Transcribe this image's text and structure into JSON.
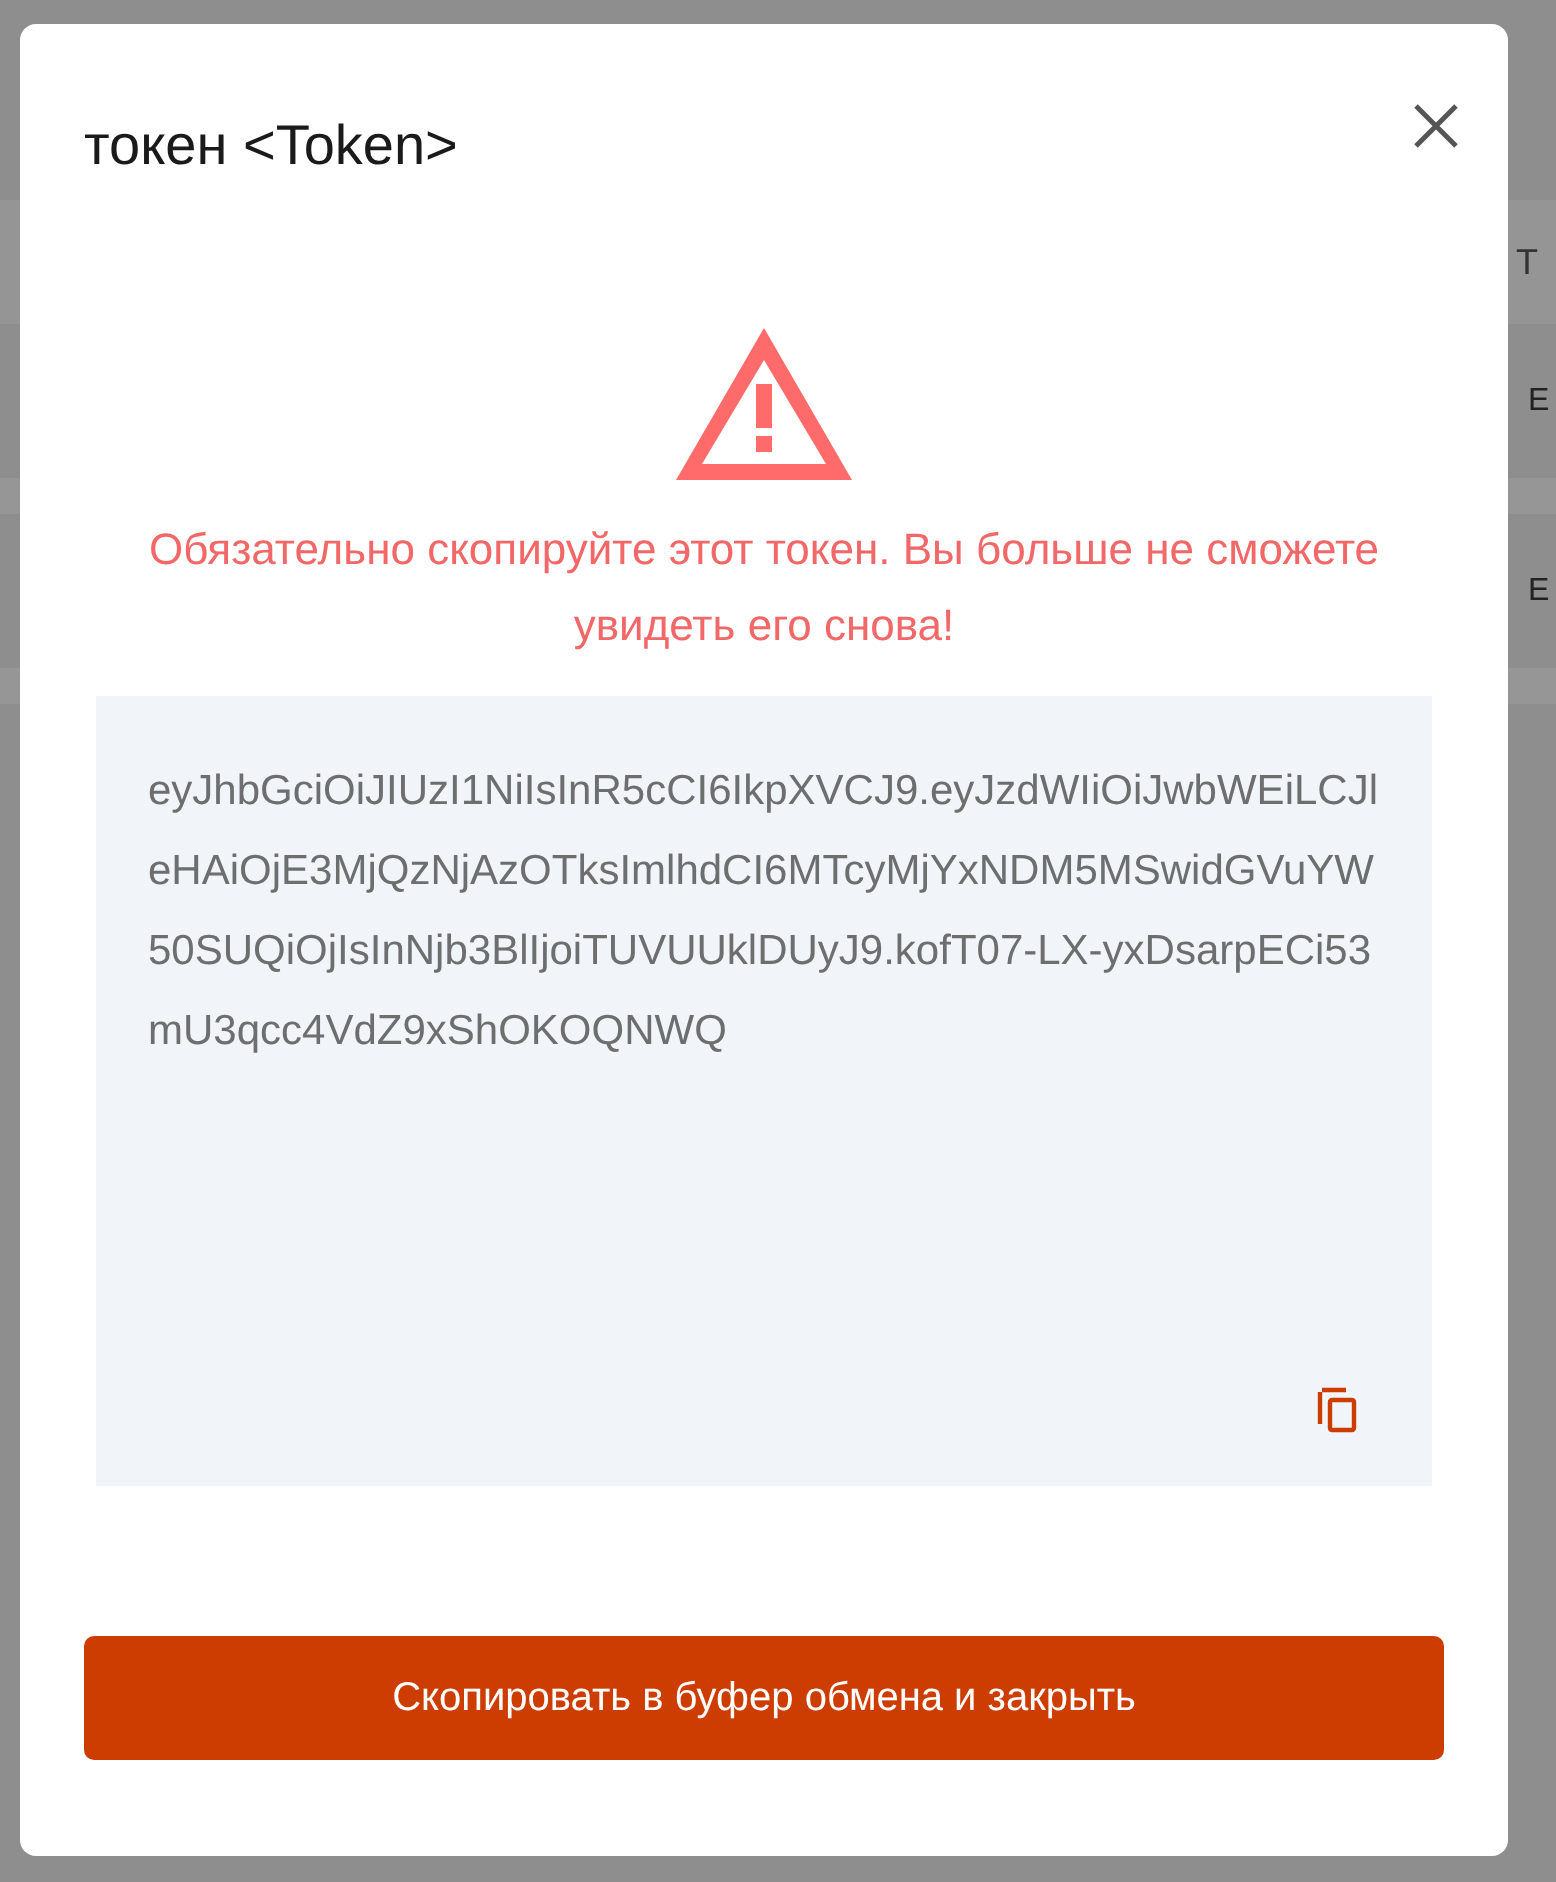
{
  "background": {
    "header_text": "T",
    "row_texts": [
      "E",
      "E"
    ]
  },
  "dialog": {
    "title": "токен <Token>",
    "warning": "Обязательно скопируйте этот токен. Вы больше не сможете увидеть его снова!",
    "token": "eyJhbGciOiJIUzI1NiIsInR5cCI6IkpXVCJ9.eyJzdWIiOiJwbWEiLCJleHAiOjE3MjQzNjAzOTksImlhdCI6MTcyMjYxNDM5MSwidGVuYW50SUQiOjIsInNjb3BlIjoiTUVUUklDUyJ9.kofT07-LX-yxDsarpECi53mU3qcc4VdZ9xShOKOQNWQ",
    "button": "Скопировать в буфер обмена и закрыть"
  }
}
